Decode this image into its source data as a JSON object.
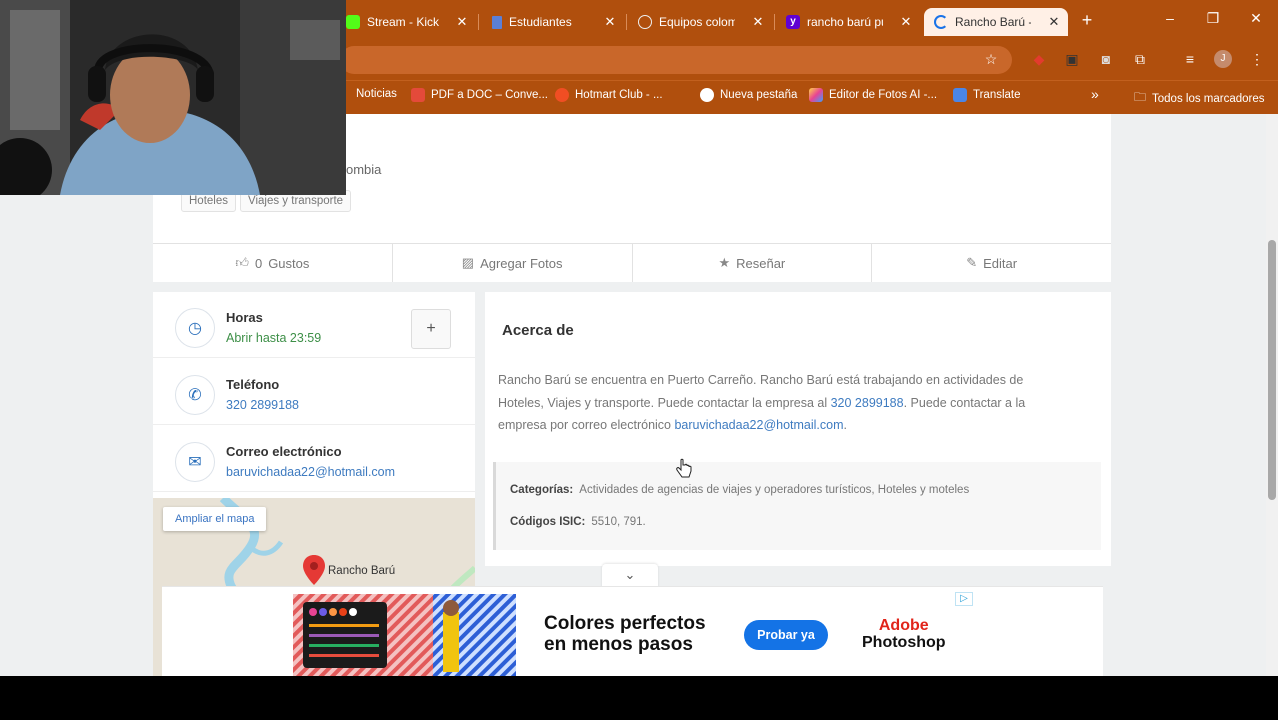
{
  "browser": {
    "tabs": [
      {
        "label": "Stream - Kick D",
        "icon": "kick-icon",
        "color": "#53fc18"
      },
      {
        "label": "Estudiantes",
        "icon": "doc-icon",
        "color": "#5b7fd6"
      },
      {
        "label": "Equipos colomb",
        "icon": "globe-icon",
        "color": "#e8e8e8"
      },
      {
        "label": "rancho barú pue",
        "icon": "yahoo-icon",
        "color": "#6001d2"
      },
      {
        "label": "Rancho Barú - P",
        "icon": "loading-icon",
        "color": "#1a73e8"
      }
    ],
    "new_tab": "+",
    "bookmarks": [
      {
        "label": "Noticias",
        "icon": "news-icon",
        "color": "#d14a1b"
      },
      {
        "label": "PDF a DOC – Conve...",
        "icon": "pdf-icon",
        "color": "#e44a3a"
      },
      {
        "label": "Hotmart Club - ...",
        "icon": "hotmart-icon",
        "color": "#f04e23"
      },
      {
        "label": "Nueva pestaña",
        "icon": "chrome-icon",
        "color": "#ffffff"
      },
      {
        "label": "Editor de Fotos AI -...",
        "icon": "editor-icon",
        "color": "#ffd54a"
      },
      {
        "label": "Translate",
        "icon": "translate-icon",
        "color": "#4a86e8"
      }
    ],
    "bookmarks_overflow": "»",
    "all_bookmarks": "Todos los marcadores",
    "profile_initial": "J"
  },
  "listing": {
    "location_partial": "ombia",
    "tags": [
      "Hoteles",
      "Viajes y transporte"
    ],
    "actions": {
      "likes_count": "0",
      "likes_label": "Gustos",
      "add_photos": "Agregar Fotos",
      "review": "Reseñar",
      "edit": "Editar"
    },
    "hours": {
      "label": "Horas",
      "value": "Abrir hasta 23:59"
    },
    "phone": {
      "label": "Teléfono",
      "value": "320 2899188"
    },
    "email": {
      "label": "Correo electrónico",
      "value": "baruvichadaa22@hotmail.com"
    },
    "map": {
      "expand_button": "Ampliar el mapa",
      "pin_label": "Rancho Barú"
    },
    "about": {
      "title": "Acerca de",
      "text_1": "Rancho Barú se encuentra en Puerto Carreño. Rancho Barú está trabajando en actividades de Hoteles, Viajes y transporte. Puede contactar la empresa al ",
      "phone_link": "320 2899188",
      "text_2": ". Puede contactar a la empresa por correo electrónico ",
      "email_link": "baruvichadaa22@hotmail.com",
      "text_3": ".",
      "categories_label": "Categorías:",
      "categories_value": "Actividades de agencias de viajes y operadores turísticos, Hoteles y moteles",
      "isic_label": "Códigos ISIC:",
      "isic_value": "5510, 791."
    }
  },
  "ad": {
    "headline_1": "Colores perfectos",
    "headline_2": "en menos pasos",
    "cta": "Probar ya",
    "brand_1": "Adobe",
    "brand_2": "Photoshop",
    "ad_choices": "▷"
  },
  "colors": {
    "chrome_bg": "#b04f0d",
    "link": "#3e7bc0",
    "open_green": "#3d8f47",
    "adobe_red": "#e1251b",
    "cta_blue": "#1473e6"
  }
}
